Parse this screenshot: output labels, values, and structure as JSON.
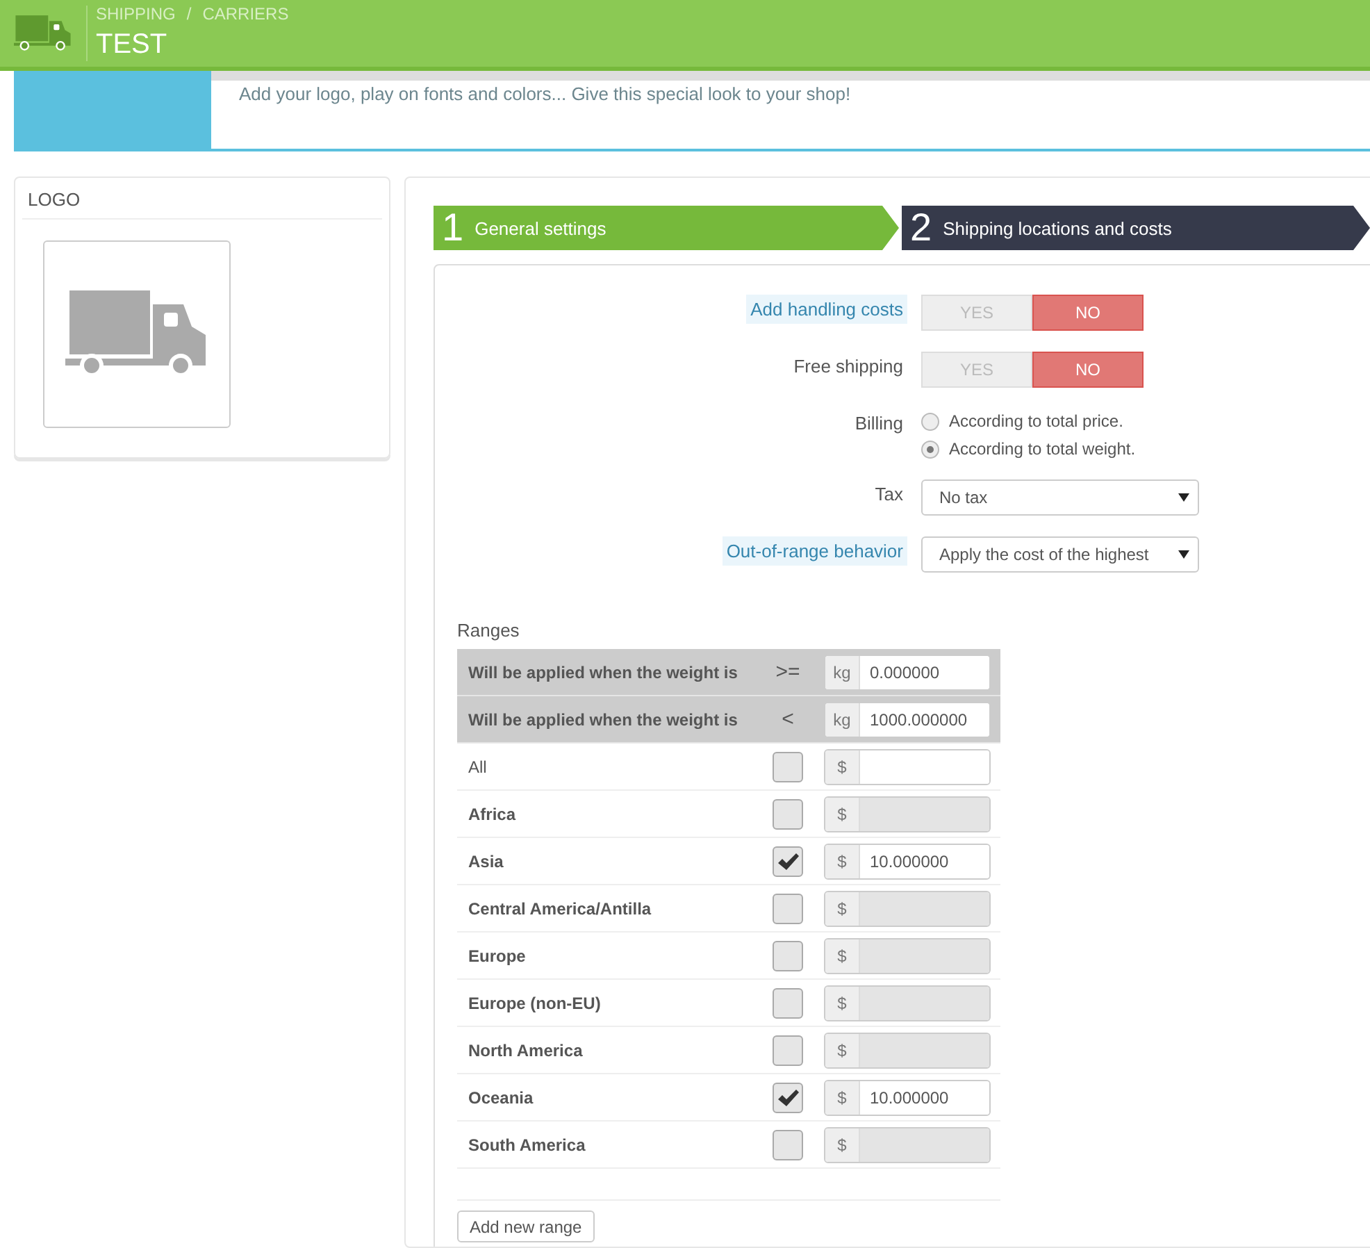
{
  "header": {
    "breadcrumb": [
      "SHIPPING",
      "CARRIERS"
    ],
    "breadcrumb_separator": "/",
    "title": "TEST"
  },
  "banner": {
    "lines": [
      "Add your logo, play on fonts and colors... Give this special look to your shop!"
    ]
  },
  "logo_panel": {
    "title": "LOGO"
  },
  "steps": [
    {
      "number": "1",
      "label": "General settings",
      "selected": false
    },
    {
      "number": "2",
      "label": "Shipping locations and costs",
      "selected": true
    }
  ],
  "form": {
    "fields": [
      {
        "kind": "toggle",
        "label": "Add handling costs",
        "help": true,
        "options": [
          "YES",
          "NO"
        ],
        "on": false
      },
      {
        "kind": "toggle",
        "label": "Free shipping",
        "help": false,
        "options": [
          "YES",
          "NO"
        ],
        "on": false
      },
      {
        "kind": "radio",
        "label": "Billing",
        "help": false,
        "options": [
          {
            "label": "According to total price.",
            "selected": false
          },
          {
            "label": "According to total weight.",
            "selected": true
          }
        ]
      },
      {
        "kind": "select",
        "label": "Tax",
        "help": false,
        "value": "No tax"
      },
      {
        "kind": "select",
        "label": "Out-of-range behavior",
        "help": true,
        "value": "Apply the cost of the highest"
      }
    ]
  },
  "ranges": {
    "title": "Ranges",
    "bounds": [
      {
        "label": "Will be applied when the weight is",
        "operator": ">=",
        "unit": "kg",
        "value": "0.000000"
      },
      {
        "label": "Will be applied when the weight is",
        "operator": "<",
        "unit": "kg",
        "value": "1000.000000"
      }
    ],
    "zones": [
      {
        "kind": "all",
        "name": "All",
        "checked": false,
        "disabled": false,
        "currency": "$"
      },
      {
        "kind": "zone",
        "name": "Africa",
        "checked": false,
        "disabled": true,
        "currency": "$"
      },
      {
        "kind": "zone",
        "name": "Asia",
        "checked": true,
        "disabled": false,
        "currency": "$",
        "value": "10.000000"
      },
      {
        "kind": "zone",
        "name": "Central America/Antilla",
        "checked": false,
        "disabled": true,
        "currency": "$"
      },
      {
        "kind": "zone",
        "name": "Europe",
        "checked": false,
        "disabled": true,
        "currency": "$"
      },
      {
        "kind": "zone",
        "name": "Europe (non-EU)",
        "checked": false,
        "disabled": true,
        "currency": "$"
      },
      {
        "kind": "zone",
        "name": "North America",
        "checked": false,
        "disabled": true,
        "currency": "$"
      },
      {
        "kind": "zone",
        "name": "Oceania",
        "checked": true,
        "disabled": false,
        "currency": "$",
        "value": "10.000000"
      },
      {
        "kind": "zone",
        "name": "South America",
        "checked": false,
        "disabled": true,
        "currency": "$"
      }
    ],
    "add_button": "Add new range"
  }
}
